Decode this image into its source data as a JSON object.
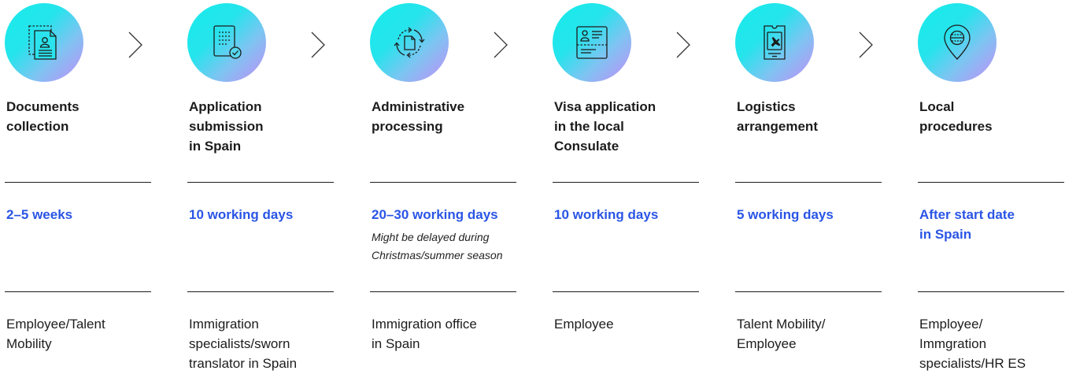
{
  "steps": [
    {
      "icon": "documents-icon",
      "title": "Documents\ncollection",
      "duration": "2–5 weeks",
      "note": "",
      "responsible": "Employee/Talent\nMobility"
    },
    {
      "icon": "application-check-icon",
      "title": "Application\nsubmission\nin Spain",
      "duration": "10 working days",
      "note": "",
      "responsible": "Immigration\nspecialists/sworn\ntranslator in Spain"
    },
    {
      "icon": "processing-cycle-icon",
      "title": "Administrative\nprocessing",
      "duration": "20–30 working days",
      "note": "Might be delayed during\nChristmas/summer season",
      "responsible": "Immigration office\nin Spain"
    },
    {
      "icon": "visa-id-icon",
      "title": "Visa application\nin the local\nConsulate",
      "duration": "10 working days",
      "note": "",
      "responsible": "Employee"
    },
    {
      "icon": "boarding-pass-icon",
      "title": "Logistics\narrangement",
      "duration": "5 working days",
      "note": "",
      "responsible": "Talent Mobility/\nEmployee"
    },
    {
      "icon": "location-pin-icon",
      "title": "Local\nprocedures",
      "duration": "After start date\nin Spain",
      "note": "",
      "responsible": "Employee/\nImmgration\nspecialists/HR ES"
    }
  ],
  "colors": {
    "accent_text": "#2a55e5",
    "gradient_start": "#18ecea",
    "gradient_end": "#c48cf6",
    "line": "#1c1c1c"
  }
}
